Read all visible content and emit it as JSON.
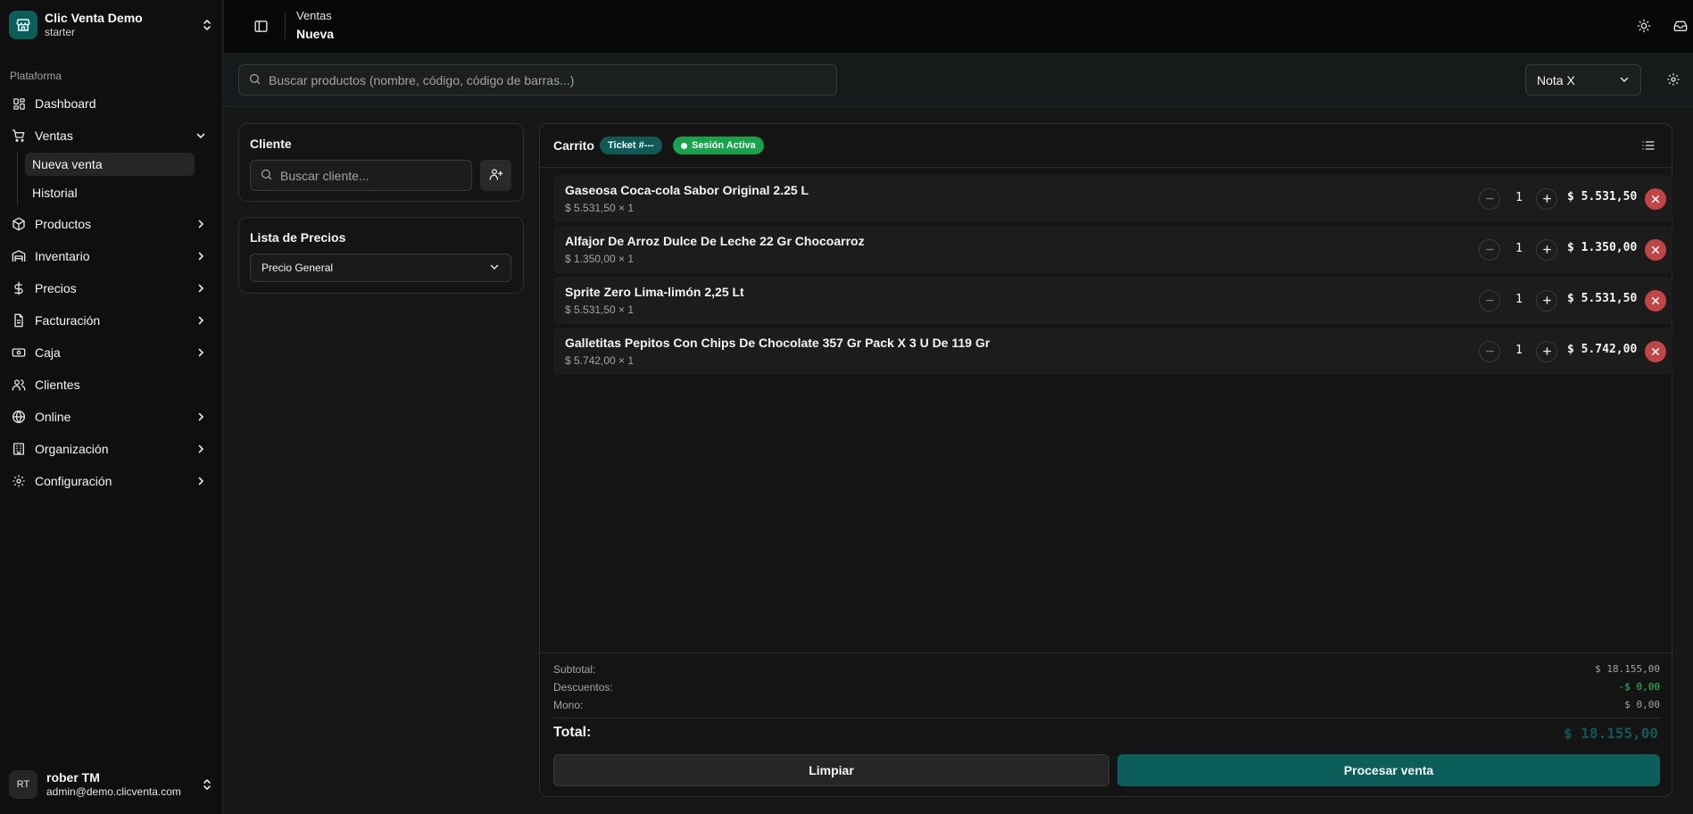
{
  "brand": {
    "name": "Clic Venta Demo",
    "plan": "starter"
  },
  "sidebar": {
    "section": "Plataforma",
    "items": [
      {
        "label": "Dashboard",
        "icon": "dashboard-icon"
      },
      {
        "label": "Ventas",
        "icon": "cart-icon",
        "expanded": true
      },
      {
        "label": "Productos",
        "icon": "box-icon"
      },
      {
        "label": "Inventario",
        "icon": "warehouse-icon"
      },
      {
        "label": "Precios",
        "icon": "dollar-icon"
      },
      {
        "label": "Facturación",
        "icon": "receipt-icon"
      },
      {
        "label": "Caja",
        "icon": "cash-icon"
      },
      {
        "label": "Clientes",
        "icon": "users-icon"
      },
      {
        "label": "Online",
        "icon": "globe-icon"
      },
      {
        "label": "Organización",
        "icon": "building-icon"
      },
      {
        "label": "Configuración",
        "icon": "gear-icon"
      }
    ],
    "ventas_sub": [
      {
        "label": "Nueva venta",
        "active": true
      },
      {
        "label": "Historial",
        "active": false
      }
    ]
  },
  "user": {
    "initials": "RT",
    "name": "rober TM",
    "email": "admin@demo.clicventa.com"
  },
  "header": {
    "crumb_parent": "Ventas",
    "crumb_current": "Nueva"
  },
  "search": {
    "placeholder": "Buscar productos (nombre, código, código de barras...)",
    "value": ""
  },
  "doc_type": {
    "selected": "Nota X"
  },
  "client_panel": {
    "title": "Cliente",
    "search_placeholder": "Buscar cliente..."
  },
  "price_list": {
    "title": "Lista de Precios",
    "selected": "Precio General"
  },
  "cart": {
    "title": "Carrito",
    "ticket_badge": "Ticket #---",
    "session_badge": "Sesión Activa",
    "items": [
      {
        "name": "Gaseosa Coca-cola Sabor Original 2.25 L",
        "unit_line": "$ 5.531,50 × 1",
        "qty": "1",
        "total": "$ 5.531,50"
      },
      {
        "name": "Alfajor De Arroz Dulce De Leche 22 Gr Chocoarroz",
        "unit_line": "$ 1.350,00 × 1",
        "qty": "1",
        "total": "$ 1.350,00"
      },
      {
        "name": "Sprite Zero Lima-limón 2,25 Lt",
        "unit_line": "$ 5.531,50 × 1",
        "qty": "1",
        "total": "$ 5.531,50"
      },
      {
        "name": "Galletitas Pepitos Con Chips De Chocolate 357 Gr Pack X 3 U De 119 Gr",
        "unit_line": "$ 5.742,00 × 1",
        "qty": "1",
        "total": "$ 5.742,00"
      }
    ],
    "summary": {
      "subtotal_label": "Subtotal:",
      "subtotal": "$ 18.155,00",
      "discount_label": "Descuentos:",
      "discount": "-$ 0,00",
      "mono_label": "Mono:",
      "mono": "$ 0,00",
      "total_label": "Total:",
      "total": "$ 18.155,00"
    },
    "clear_label": "Limpiar",
    "process_label": "Procesar venta"
  },
  "colors": {
    "accent": "#0b5e5a",
    "success": "#16a34a",
    "danger": "#c24545"
  }
}
